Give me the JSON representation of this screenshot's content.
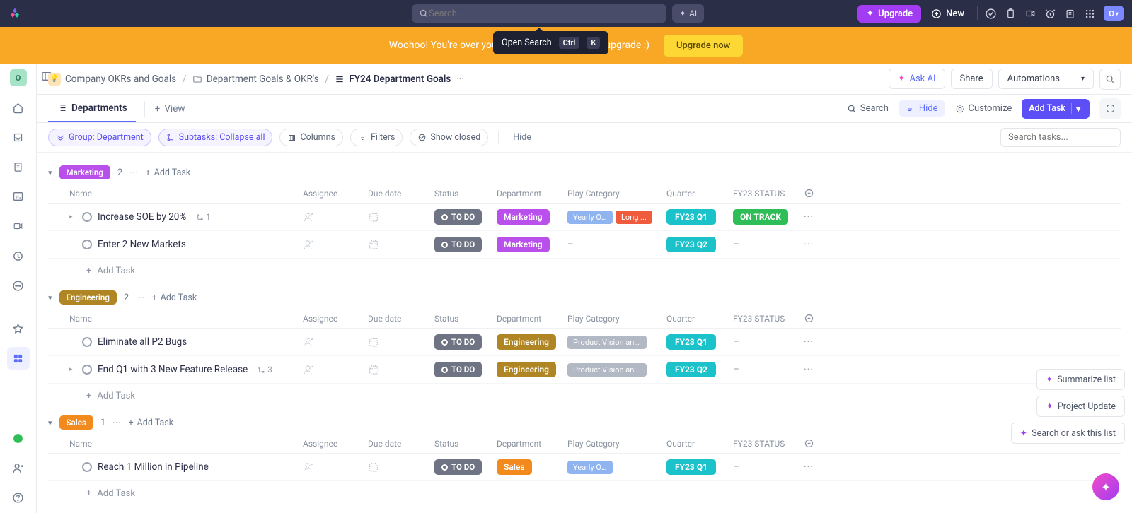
{
  "topnav": {
    "search_placeholder": "Search...",
    "ai_label": "AI",
    "upgrade_label": "Upgrade",
    "new_label": "New",
    "avatar_letter": "O"
  },
  "banner": {
    "text_left": "Woohoo! You're over your",
    "text_right": "upgrade :)",
    "button": "Upgrade now"
  },
  "tooltip": {
    "label": "Open Search",
    "kbd1": "Ctrl",
    "kbd2": "K"
  },
  "breadcrumb": {
    "root": "Company OKRs and Goals",
    "folder": "Department Goals & OKR's",
    "list": "FY24 Department Goals",
    "ask_ai": "Ask AI",
    "share": "Share",
    "automations": "Automations"
  },
  "view_bar": {
    "tab": "Departments",
    "add_view": "View",
    "search": "Search",
    "hide": "Hide",
    "customize": "Customize",
    "add_task": "Add Task"
  },
  "filters": {
    "group": "Group: Department",
    "subtasks": "Subtasks: Collapse all",
    "columns": "Columns",
    "filters": "Filters",
    "show_closed": "Show closed",
    "hide": "Hide",
    "search_placeholder": "Search tasks..."
  },
  "columns": {
    "name": "Name",
    "assignee": "Assignee",
    "due": "Due date",
    "status": "Status",
    "department": "Department",
    "play": "Play Category",
    "quarter": "Quarter",
    "fy23": "FY23 STATUS"
  },
  "add_task_row": "Add Task",
  "groups": [
    {
      "name": "Marketing",
      "pill_class": "marketing",
      "count": "2",
      "add_label": "Add Task",
      "tasks": [
        {
          "expandable": true,
          "name": "Increase SOE by 20%",
          "subtasks": "1",
          "status": "TO DO",
          "dept": "Marketing",
          "dept_class": "marketing",
          "play": [
            {
              "label": "Yearly OK...",
              "class": "blue"
            },
            {
              "label": "Long ...",
              "class": "red"
            }
          ],
          "quarter": "FY23 Q1",
          "fy23": "ON TRACK"
        },
        {
          "expandable": false,
          "name": "Enter 2 New Markets",
          "subtasks": null,
          "status": "TO DO",
          "dept": "Marketing",
          "dept_class": "marketing",
          "play": [],
          "play_empty": "–",
          "quarter": "FY23 Q2",
          "fy23_empty": "–"
        }
      ]
    },
    {
      "name": "Engineering",
      "pill_class": "engineering",
      "count": "2",
      "add_label": "Add Task",
      "tasks": [
        {
          "expandable": false,
          "name": "Eliminate all P2 Bugs",
          "subtasks": null,
          "status": "TO DO",
          "dept": "Engineering",
          "dept_class": "engineering",
          "play": [
            {
              "label": "Product Vision and ...",
              "class": "gray"
            }
          ],
          "quarter": "FY23 Q1",
          "fy23_empty": "–"
        },
        {
          "expandable": true,
          "name": "End Q1 with 3 New Feature Release",
          "subtasks": "3",
          "status": "TO DO",
          "dept": "Engineering",
          "dept_class": "engineering",
          "play": [
            {
              "label": "Product Vision and ...",
              "class": "gray"
            }
          ],
          "quarter": "FY23 Q2",
          "fy23_empty": "–"
        }
      ]
    },
    {
      "name": "Sales",
      "pill_class": "sales",
      "count": "1",
      "add_label": "Add Task",
      "tasks": [
        {
          "expandable": false,
          "name": "Reach 1 Million in Pipeline",
          "subtasks": null,
          "status": "TO DO",
          "dept": "Sales",
          "dept_class": "sales",
          "play": [
            {
              "label": "Yearly OKR Sets",
              "class": "blue"
            }
          ],
          "quarter": "FY23 Q1",
          "fy23_empty": "–"
        }
      ]
    }
  ],
  "float": {
    "summarize": "Summarize list",
    "project_update": "Project Update",
    "search_ask": "Search or ask this list"
  },
  "sidebar": {
    "ws_letter": "O"
  }
}
